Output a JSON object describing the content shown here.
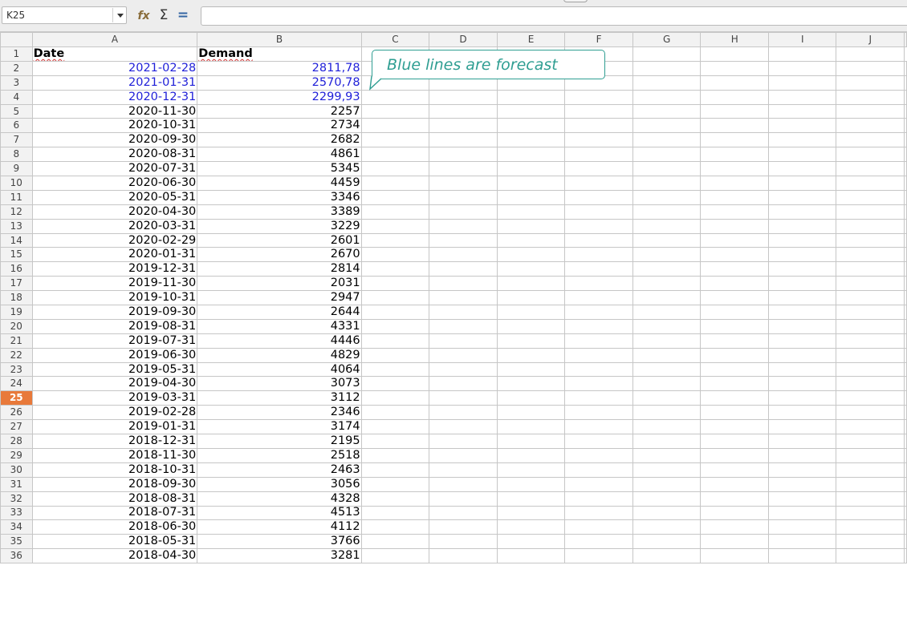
{
  "formula_bar": {
    "name_box": "K25",
    "input": "",
    "icons": [
      "chevron-down-icon",
      "function-wizard-icon",
      "sum-icon",
      "formula-icon"
    ],
    "sum_glyph": "Σ",
    "formula_glyph": "=",
    "wizard_glyph": "fx"
  },
  "columns": [
    "A",
    "B",
    "C",
    "D",
    "E",
    "F",
    "G",
    "H",
    "I",
    "J"
  ],
  "active_row": 25,
  "colors": {
    "forecast_text": "#1f1fd8",
    "callout": "#2f9e92",
    "active_row_header": "#e8793a"
  },
  "callout": {
    "text": "Blue lines are forecast"
  },
  "table": {
    "headers": {
      "date": "Date",
      "demand": "Demand"
    },
    "rows": [
      {
        "row": "2",
        "date": "2021-02-28",
        "demand": "2811,78",
        "forecast": true
      },
      {
        "row": "3",
        "date": "2021-01-31",
        "demand": "2570,78",
        "forecast": true
      },
      {
        "row": "4",
        "date": "2020-12-31",
        "demand": "2299,93",
        "forecast": true
      },
      {
        "row": "5",
        "date": "2020-11-30",
        "demand": "2257",
        "forecast": false
      },
      {
        "row": "6",
        "date": "2020-10-31",
        "demand": "2734",
        "forecast": false
      },
      {
        "row": "7",
        "date": "2020-09-30",
        "demand": "2682",
        "forecast": false
      },
      {
        "row": "8",
        "date": "2020-08-31",
        "demand": "4861",
        "forecast": false
      },
      {
        "row": "9",
        "date": "2020-07-31",
        "demand": "5345",
        "forecast": false
      },
      {
        "row": "10",
        "date": "2020-06-30",
        "demand": "4459",
        "forecast": false
      },
      {
        "row": "11",
        "date": "2020-05-31",
        "demand": "3346",
        "forecast": false
      },
      {
        "row": "12",
        "date": "2020-04-30",
        "demand": "3389",
        "forecast": false
      },
      {
        "row": "13",
        "date": "2020-03-31",
        "demand": "3229",
        "forecast": false
      },
      {
        "row": "14",
        "date": "2020-02-29",
        "demand": "2601",
        "forecast": false
      },
      {
        "row": "15",
        "date": "2020-01-31",
        "demand": "2670",
        "forecast": false
      },
      {
        "row": "16",
        "date": "2019-12-31",
        "demand": "2814",
        "forecast": false
      },
      {
        "row": "17",
        "date": "2019-11-30",
        "demand": "2031",
        "forecast": false
      },
      {
        "row": "18",
        "date": "2019-10-31",
        "demand": "2947",
        "forecast": false
      },
      {
        "row": "19",
        "date": "2019-09-30",
        "demand": "2644",
        "forecast": false
      },
      {
        "row": "20",
        "date": "2019-08-31",
        "demand": "4331",
        "forecast": false
      },
      {
        "row": "21",
        "date": "2019-07-31",
        "demand": "4446",
        "forecast": false
      },
      {
        "row": "22",
        "date": "2019-06-30",
        "demand": "4829",
        "forecast": false
      },
      {
        "row": "23",
        "date": "2019-05-31",
        "demand": "4064",
        "forecast": false
      },
      {
        "row": "24",
        "date": "2019-04-30",
        "demand": "3073",
        "forecast": false
      },
      {
        "row": "25",
        "date": "2019-03-31",
        "demand": "3112",
        "forecast": false
      },
      {
        "row": "26",
        "date": "2019-02-28",
        "demand": "2346",
        "forecast": false
      },
      {
        "row": "27",
        "date": "2019-01-31",
        "demand": "3174",
        "forecast": false
      },
      {
        "row": "28",
        "date": "2018-12-31",
        "demand": "2195",
        "forecast": false
      },
      {
        "row": "29",
        "date": "2018-11-30",
        "demand": "2518",
        "forecast": false
      },
      {
        "row": "30",
        "date": "2018-10-31",
        "demand": "2463",
        "forecast": false
      },
      {
        "row": "31",
        "date": "2018-09-30",
        "demand": "3056",
        "forecast": false
      },
      {
        "row": "32",
        "date": "2018-08-31",
        "demand": "4328",
        "forecast": false
      },
      {
        "row": "33",
        "date": "2018-07-31",
        "demand": "4513",
        "forecast": false
      },
      {
        "row": "34",
        "date": "2018-06-30",
        "demand": "4112",
        "forecast": false
      },
      {
        "row": "35",
        "date": "2018-05-31",
        "demand": "3766",
        "forecast": false
      },
      {
        "row": "36",
        "date": "2018-04-30",
        "demand": "3281",
        "forecast": false
      }
    ]
  }
}
